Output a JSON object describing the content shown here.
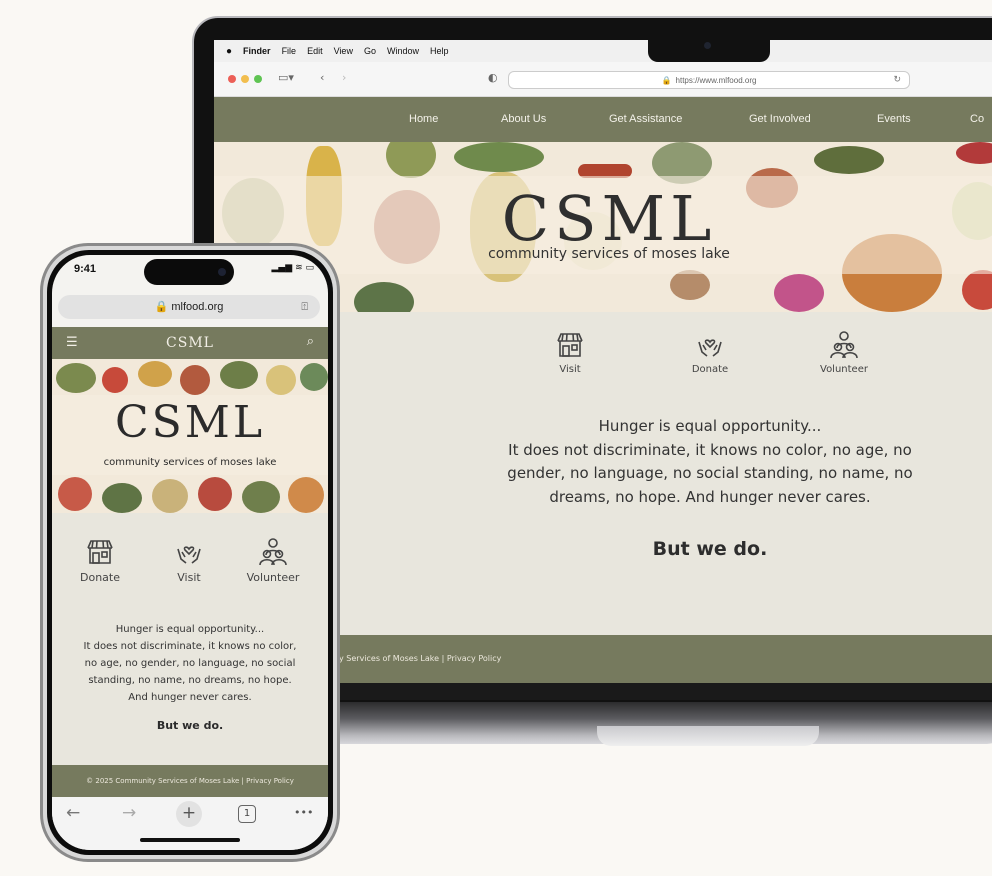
{
  "mac_menu": {
    "apple": "",
    "app": "Finder",
    "items": [
      "File",
      "Edit",
      "View",
      "Go",
      "Window",
      "Help"
    ]
  },
  "browser": {
    "url": "https://www.mlfood.org",
    "sidebar_icon": "sidebar-icon",
    "back": "‹",
    "forward": "›",
    "shield_icon": "shield-icon",
    "reload": "↻"
  },
  "nav": {
    "items": [
      "Home",
      "About Us",
      "Get Assistance",
      "Get Involved",
      "Events",
      "Co"
    ]
  },
  "hero": {
    "title": "CSML",
    "subtitle": "community services of moses lake"
  },
  "desktop_actions": [
    {
      "label": "Visit",
      "icon": "storefront-icon"
    },
    {
      "label": "Donate",
      "icon": "heart-hands-icon"
    },
    {
      "label": "Volunteer",
      "icon": "people-icon"
    }
  ],
  "tagline": {
    "lines": [
      "Hunger is equal opportunity...",
      "It does not discriminate, it knows no color, no age, no",
      "gender, no language, no social standing, no name, no",
      "dreams, no hope. And hunger never cares."
    ],
    "emphasis": "But we do."
  },
  "desktop_footer": "y Services of Moses Lake  |  Privacy Policy",
  "phone": {
    "time": "9:41",
    "status_icons": "▂▄▆ ≋ ▭",
    "url": "🔒 mlfood.org",
    "share": "⍐",
    "menu": "☰",
    "header_title": "CSML",
    "search": "⌕",
    "hero_title": "CSML",
    "hero_subtitle": "community services of moses lake",
    "actions": [
      {
        "label": "Donate",
        "icon": "storefront-icon"
      },
      {
        "label": "Visit",
        "icon": "heart-hands-icon"
      },
      {
        "label": "Volunteer",
        "icon": "people-icon"
      }
    ],
    "tagline_lines": [
      "Hunger is equal opportunity...",
      "It does not discriminate, it knows no color,",
      "no age, no gender, no language, no social",
      "standing, no name, no dreams, no hope.",
      "And hunger never cares."
    ],
    "emphasis": "But we do.",
    "footer": "© 2025 Community Services of Moses Lake  |  Privacy Policy",
    "toolbar": {
      "back": "←",
      "forward": "→",
      "new_tab": "+",
      "tabs": "1",
      "more": "•••"
    }
  },
  "colors": {
    "olive": "#767a5e",
    "cream": "#e8e6dd",
    "hero_bg": "#f2e9da"
  }
}
